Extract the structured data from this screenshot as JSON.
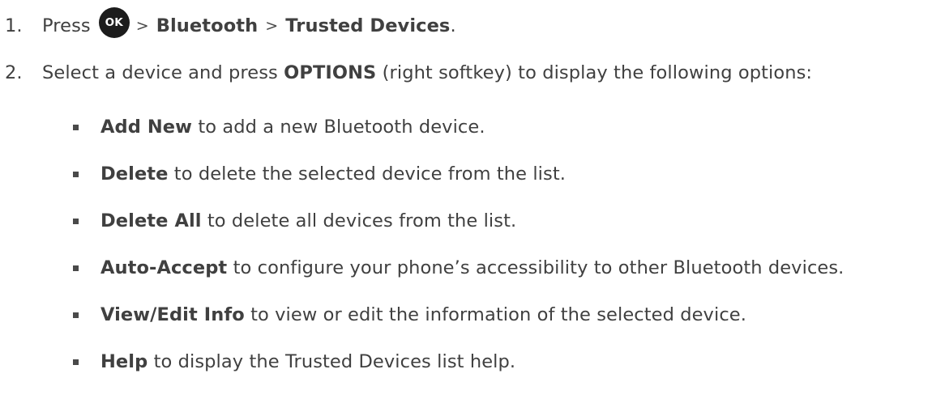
{
  "steps": [
    {
      "number": "1.",
      "text_before": "Press",
      "key_label": "OK",
      "separator": ">",
      "path": [
        "Bluetooth",
        "Trusted Devices"
      ],
      "text_after": "."
    },
    {
      "number": "2.",
      "text_before": "Select a device and press",
      "bold": "OPTIONS",
      "text_after": "(right softkey) to display the following options:"
    }
  ],
  "options": [
    {
      "term": "Add New",
      "description": "to add a new Bluetooth device."
    },
    {
      "term": "Delete",
      "description": "to delete the selected device from the list."
    },
    {
      "term": "Delete All",
      "description": "to delete all devices from the list."
    },
    {
      "term": "Auto-Accept",
      "description": "to configure your phone’s accessibility to other Bluetooth devices."
    },
    {
      "term": "View/Edit Info",
      "description": "to view or edit the information of the selected device."
    },
    {
      "term": "Help",
      "description": "to display the Trusted Devices list help."
    }
  ],
  "icons": {
    "ok_key": "ok-key-icon",
    "bullet": "square-bullet-icon"
  },
  "colors": {
    "text": "#404040",
    "ok_key_background": "#1c1c1c"
  }
}
